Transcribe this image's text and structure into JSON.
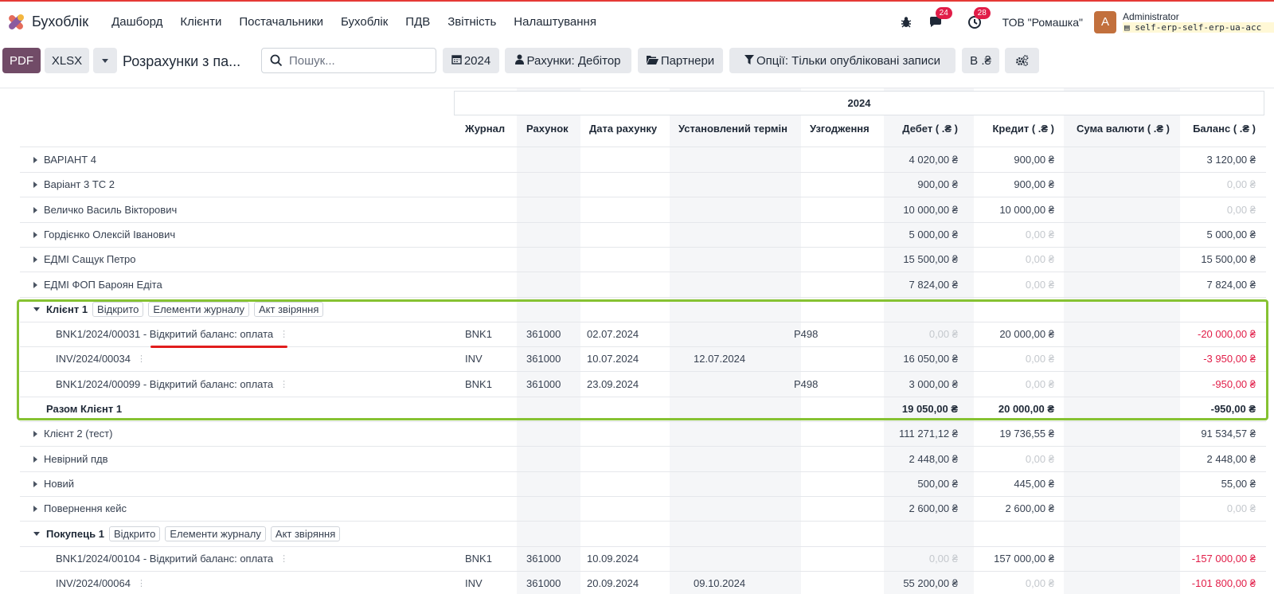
{
  "app": {
    "name": "Бухоблік"
  },
  "menu": [
    "Дашборд",
    "Клієнти",
    "Постачальники",
    "Бухоблік",
    "ПДВ",
    "Звітність",
    "Налаштування"
  ],
  "topbar": {
    "messages_count": "24",
    "activities_count": "28",
    "company": "ТОВ \"Ромашка\"",
    "avatar_letter": "A",
    "user": "Administrator",
    "database": "self-erp-self-erp-ua-acc"
  },
  "controls": {
    "pdf": "PDF",
    "xlsx": "XLSX",
    "report_title": "Розрахунки з па...",
    "search_placeholder": "Пошук...",
    "filter_year": "2024",
    "filter_accounts": "Рахунки: Дебітор",
    "filter_partners": "Партнери",
    "filter_options": "Опції: Тільки опубліковані записи",
    "filter_currency": "В .₴"
  },
  "table": {
    "period": "2024",
    "columns": {
      "journal": "Журнал",
      "account": "Рахунок",
      "invoice_date": "Дата рахунку",
      "due_date": "Установлений термін",
      "matching": "Узгодження",
      "debit": "Дебет ( .₴ )",
      "credit": "Кредит ( .₴ )",
      "currency_amount": "Сума валюти ( .₴ )",
      "balance": "Баланс ( .₴ )"
    },
    "chips": {
      "open": "Відкрито",
      "journal_items": "Елементи журналу",
      "reconciliation": "Акт звіряння"
    },
    "rows": [
      {
        "kind": "partner",
        "name": "ВАРІАНТ 4",
        "debit": "4 020,00 ₴",
        "credit": "900,00 ₴",
        "balance": "3 120,00 ₴"
      },
      {
        "kind": "partner",
        "name": "Варіант 3 ТС 2",
        "debit": "900,00 ₴",
        "credit": "900,00 ₴",
        "balance": "0,00 ₴"
      },
      {
        "kind": "partner",
        "name": "Величко Василь Вікторович",
        "debit": "10 000,00 ₴",
        "credit": "10 000,00 ₴",
        "balance": "0,00 ₴"
      },
      {
        "kind": "partner",
        "name": "Гордієнко Олексій Іванович",
        "debit": "5 000,00 ₴",
        "credit": "0,00 ₴",
        "balance": "5 000,00 ₴"
      },
      {
        "kind": "partner",
        "name": "ЕДМІ Сащук Петро",
        "debit": "15 500,00 ₴",
        "credit": "0,00 ₴",
        "balance": "15 500,00 ₴"
      },
      {
        "kind": "partner",
        "name": "ЕДМІ ФОП Бароян Едіта",
        "debit": "7 824,00 ₴",
        "credit": "0,00 ₴",
        "balance": "7 824,00 ₴"
      },
      {
        "kind": "expanded",
        "name": "Клієнт 1"
      },
      {
        "kind": "line",
        "name": "BNK1/2024/00031 - Відкритий баланс: оплата",
        "journal": "BNK1",
        "account": "361000",
        "invoice_date": "02.07.2024",
        "due_date": "",
        "matching": "P498",
        "debit": "0,00 ₴",
        "credit": "20 000,00 ₴",
        "balance": "-20 000,00 ₴"
      },
      {
        "kind": "line",
        "name": "INV/2024/00034",
        "journal": "INV",
        "account": "361000",
        "invoice_date": "10.07.2024",
        "due_date": "12.07.2024",
        "matching": "",
        "debit": "16 050,00 ₴",
        "credit": "0,00 ₴",
        "balance": "-3 950,00 ₴"
      },
      {
        "kind": "line",
        "name": "BNK1/2024/00099 - Відкритий баланс: оплата",
        "journal": "BNK1",
        "account": "361000",
        "invoice_date": "23.09.2024",
        "due_date": "",
        "matching": "P498",
        "debit": "3 000,00 ₴",
        "credit": "0,00 ₴",
        "balance": "-950,00 ₴"
      },
      {
        "kind": "total",
        "name": "Разом Клієнт 1",
        "debit": "19 050,00 ₴",
        "credit": "20 000,00 ₴",
        "balance": "-950,00 ₴"
      },
      {
        "kind": "partner",
        "name": "Клієнт 2 (тест)",
        "debit": "111 271,12 ₴",
        "credit": "19 736,55 ₴",
        "balance": "91 534,57 ₴"
      },
      {
        "kind": "partner",
        "name": "Невірний пдв",
        "debit": "2 448,00 ₴",
        "credit": "0,00 ₴",
        "balance": "2 448,00 ₴"
      },
      {
        "kind": "partner",
        "name": "Новий",
        "debit": "500,00 ₴",
        "credit": "445,00 ₴",
        "balance": "55,00 ₴"
      },
      {
        "kind": "partner",
        "name": "Повернення кейс",
        "debit": "2 600,00 ₴",
        "credit": "2 600,00 ₴",
        "balance": "0,00 ₴"
      },
      {
        "kind": "expanded",
        "name": "Покупець 1"
      },
      {
        "kind": "line",
        "name": "BNK1/2024/00104 - Відкритий баланс: оплата",
        "journal": "BNK1",
        "account": "361000",
        "invoice_date": "10.09.2024",
        "due_date": "",
        "matching": "",
        "debit": "0,00 ₴",
        "credit": "157 000,00 ₴",
        "balance": "-157 000,00 ₴"
      },
      {
        "kind": "line",
        "name": "INV/2024/00064",
        "journal": "INV",
        "account": "361000",
        "invoice_date": "20.09.2024",
        "due_date": "09.10.2024",
        "matching": "",
        "debit": "55 200,00 ₴",
        "credit": "0,00 ₴",
        "balance": "-101 800,00 ₴"
      }
    ]
  }
}
